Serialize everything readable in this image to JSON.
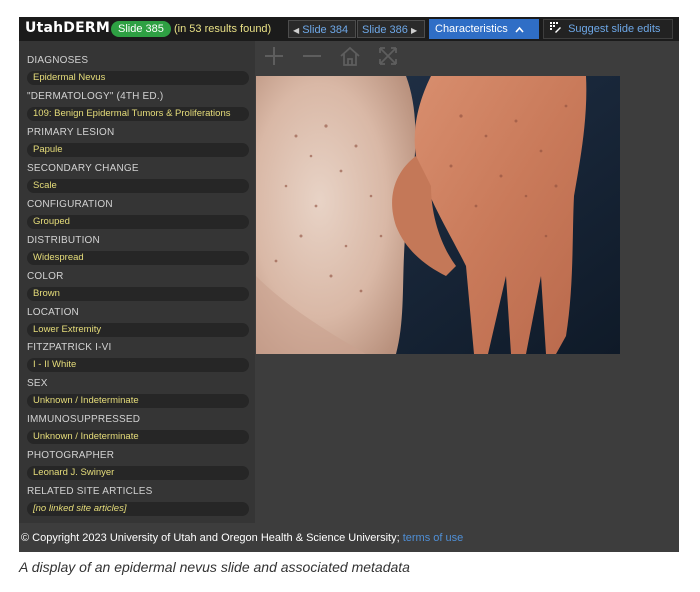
{
  "header": {
    "brand": "UtahDERM",
    "slide_badge": "Slide 385",
    "results": "(in 53 results found)",
    "prev_label": "Slide 384",
    "next_label": "Slide 386",
    "characteristics_label": "Characteristics",
    "suggest_label": "Suggest slide edits"
  },
  "sidebar": {
    "items": [
      {
        "label": "DIAGNOSES",
        "value": "Epidermal Nevus"
      },
      {
        "label": "\"DERMATOLOGY\" (4TH ED.)",
        "value": "109: Benign Epidermal Tumors & Proliferations"
      },
      {
        "label": "PRIMARY LESION",
        "value": "Papule"
      },
      {
        "label": "SECONDARY CHANGE",
        "value": "Scale"
      },
      {
        "label": "CONFIGURATION",
        "value": "Grouped"
      },
      {
        "label": "DISTRIBUTION",
        "value": "Widespread"
      },
      {
        "label": "COLOR",
        "value": "Brown"
      },
      {
        "label": "LOCATION",
        "value": "Lower Extremity"
      },
      {
        "label": "FITZPATRICK I-VI",
        "value": "I - II White"
      },
      {
        "label": "SEX",
        "value": "Unknown / Indeterminate"
      },
      {
        "label": "IMMUNOSUPPRESSED",
        "value": "Unknown / Indeterminate"
      },
      {
        "label": "PHOTOGRAPHER",
        "value": "Leonard J. Swinyer"
      },
      {
        "label": "RELATED SITE ARTICLES",
        "value": "[no linked site articles]"
      }
    ]
  },
  "footer": {
    "copyright": "© Copyright 2023 University of Utah and Oregon Health & Science University;",
    "terms_link": "terms of use"
  },
  "caption": "A display of an epidermal nevus slide and associated metadata",
  "colors": {
    "accent": "#2f6ec6",
    "badge": "#2ea043",
    "value_text": "#e6dd7a",
    "link": "#4f8fd6"
  }
}
